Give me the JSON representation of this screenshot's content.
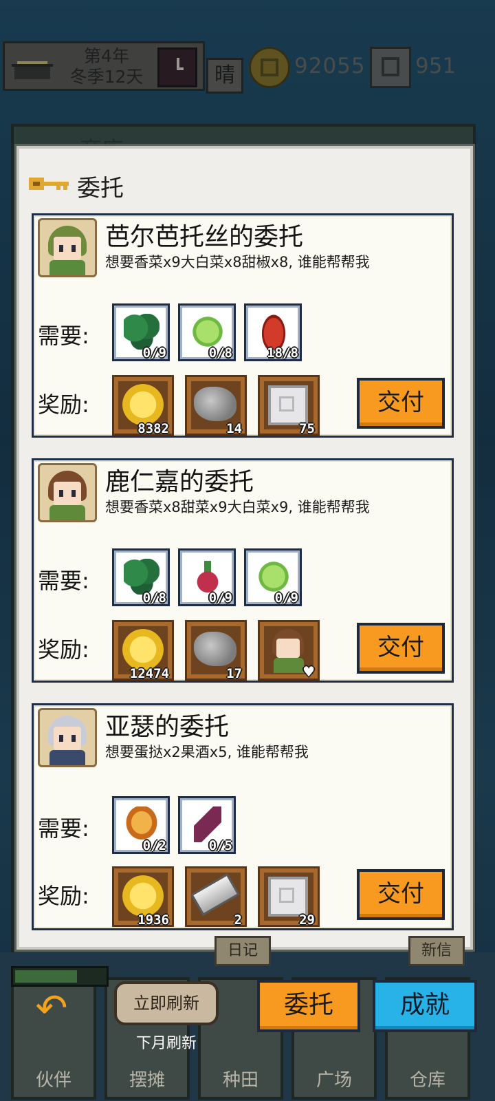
{
  "hud": {
    "date_line1": "第4年",
    "date_line2": "冬季12天",
    "weather": "晴",
    "coins": "92055",
    "gems": "951"
  },
  "background_panel": {
    "title": "商店"
  },
  "dialog": {
    "title": "委托",
    "deliver_label": "交付",
    "need_label": "需要:",
    "reward_label": "奖励:",
    "cards": [
      {
        "name": "芭尔芭托丝的委托",
        "desc": "想要香菜x9大白菜x8甜椒x8, 谁能帮帮我",
        "needs": [
          {
            "icon": "coriander-icon",
            "count": "0/9"
          },
          {
            "icon": "cabbage-icon",
            "count": "0/8"
          },
          {
            "icon": "bell-pepper-icon",
            "count": "18/8"
          }
        ],
        "rewards": [
          {
            "icon": "gold-coin-icon",
            "count": "8382"
          },
          {
            "icon": "stone-ore-icon",
            "count": "14"
          },
          {
            "icon": "silver-gem-icon",
            "count": "75"
          }
        ]
      },
      {
        "name": "鹿仁嘉的委托",
        "desc": "想要香菜x8甜菜x9大白菜x9, 谁能帮帮我",
        "needs": [
          {
            "icon": "coriander-icon",
            "count": "0/8"
          },
          {
            "icon": "beet-icon",
            "count": "0/9"
          },
          {
            "icon": "cabbage-icon",
            "count": "0/9"
          }
        ],
        "rewards": [
          {
            "icon": "gold-coin-icon",
            "count": "12474"
          },
          {
            "icon": "stone-ore-icon",
            "count": "17"
          },
          {
            "icon": "character-affection-icon",
            "count": "♥"
          }
        ]
      },
      {
        "name": "亚瑟的委托",
        "desc": "想要蛋挞x2果酒x5, 谁能帮帮我",
        "needs": [
          {
            "icon": "egg-tart-icon",
            "count": "0/2"
          },
          {
            "icon": "fruit-wine-icon",
            "count": "0/5"
          }
        ],
        "rewards": [
          {
            "icon": "gold-coin-icon",
            "count": "1936"
          },
          {
            "icon": "iron-bar-icon",
            "count": "2"
          },
          {
            "icon": "silver-gem-icon",
            "count": "29"
          }
        ]
      }
    ]
  },
  "bottom": {
    "diary": "日记",
    "new_letter": "新信",
    "refresh_now": "立即刷新",
    "refresh_note": "下月刷新",
    "entrust": "委托",
    "achievement": "成就",
    "tabs": [
      "伙伴",
      "摆摊",
      "种田",
      "广场",
      "仓库"
    ]
  }
}
